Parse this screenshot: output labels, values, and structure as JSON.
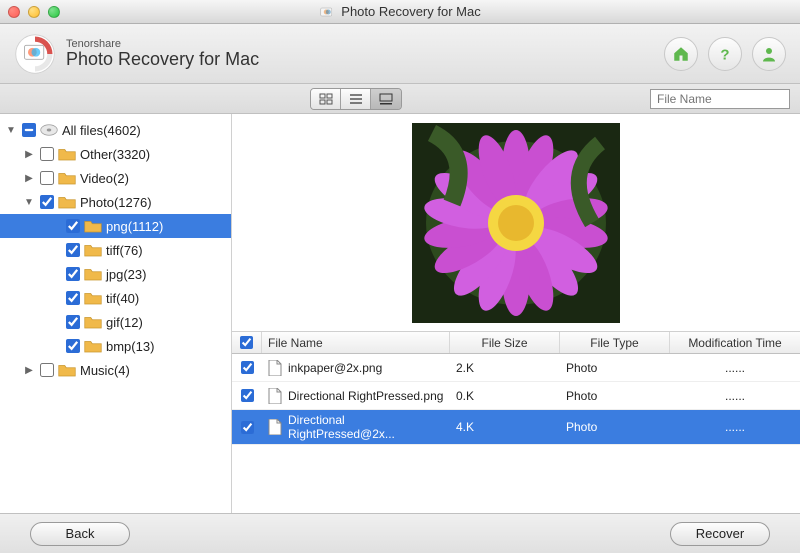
{
  "window": {
    "title": "Photo Recovery for Mac"
  },
  "header": {
    "brand_sub": "Tenorshare",
    "brand_title": "Photo Recovery for Mac",
    "icons": {
      "home": "home-icon",
      "help": "help-icon",
      "user": "user-icon"
    }
  },
  "toolbar": {
    "search_placeholder": "File Name"
  },
  "tree": [
    {
      "indent": 0,
      "expanded": true,
      "checked": "partial",
      "label": "All files(4602)",
      "icon": "drive"
    },
    {
      "indent": 1,
      "expanded": false,
      "checked": false,
      "label": "Other(3320)",
      "icon": "folder"
    },
    {
      "indent": 1,
      "expanded": false,
      "checked": false,
      "label": "Video(2)",
      "icon": "folder"
    },
    {
      "indent": 1,
      "expanded": true,
      "checked": true,
      "label": "Photo(1276)",
      "icon": "folder"
    },
    {
      "indent": 2,
      "expanded": null,
      "checked": true,
      "label": "png(1112)",
      "icon": "folder",
      "selected": true
    },
    {
      "indent": 2,
      "expanded": null,
      "checked": true,
      "label": "tiff(76)",
      "icon": "folder"
    },
    {
      "indent": 2,
      "expanded": null,
      "checked": true,
      "label": "jpg(23)",
      "icon": "folder"
    },
    {
      "indent": 2,
      "expanded": null,
      "checked": true,
      "label": "tif(40)",
      "icon": "folder"
    },
    {
      "indent": 2,
      "expanded": null,
      "checked": true,
      "label": "gif(12)",
      "icon": "folder"
    },
    {
      "indent": 2,
      "expanded": null,
      "checked": true,
      "label": "bmp(13)",
      "icon": "folder"
    },
    {
      "indent": 1,
      "expanded": false,
      "checked": false,
      "label": "Music(4)",
      "icon": "folder"
    }
  ],
  "table": {
    "columns": {
      "name": "File Name",
      "size": "File Size",
      "type": "File Type",
      "time": "Modification Time"
    },
    "rows": [
      {
        "checked": true,
        "name": "inkpaper@2x.png",
        "size": "2.K",
        "type": "Photo",
        "time": "......",
        "selected": false
      },
      {
        "checked": true,
        "name": "Directional RightPressed.png",
        "size": "0.K",
        "type": "Photo",
        "time": "......",
        "selected": false
      },
      {
        "checked": true,
        "name": "Directional RightPressed@2x...",
        "size": "4.K",
        "type": "Photo",
        "time": "......",
        "selected": true
      }
    ]
  },
  "footer": {
    "back": "Back",
    "recover": "Recover"
  },
  "colors": {
    "selection": "#3b7de0",
    "folder": "#f0b94a",
    "accent_green": "#5fb84e"
  }
}
